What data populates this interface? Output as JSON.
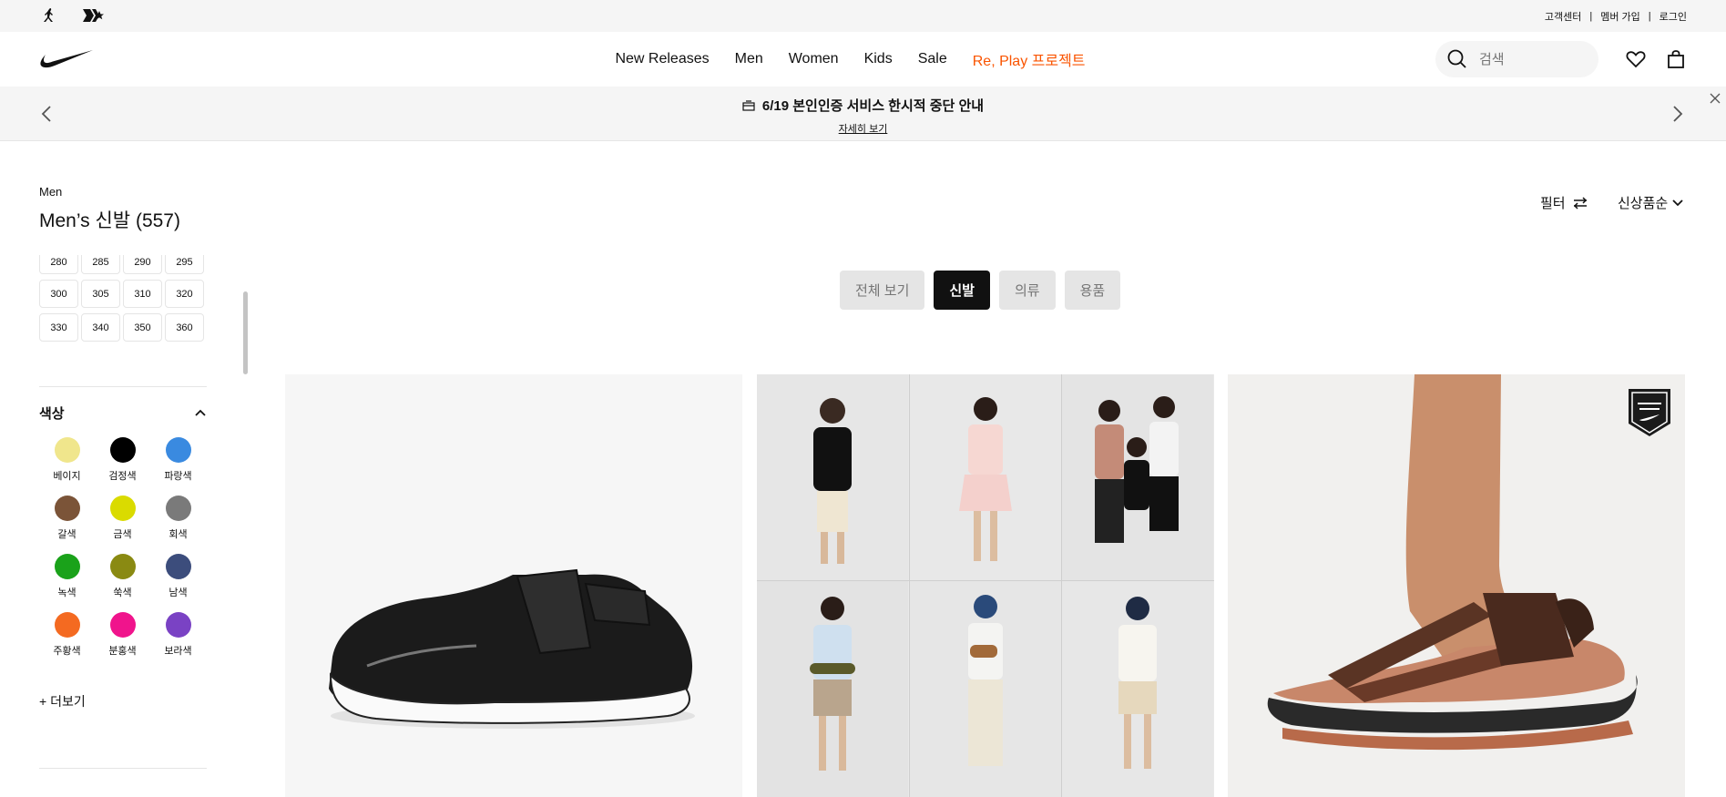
{
  "utility": {
    "links": [
      "고객센터",
      "멤버 가입",
      "로그인"
    ]
  },
  "nav": {
    "items": [
      "New Releases",
      "Men",
      "Women",
      "Kids",
      "Sale",
      "Re, Play 프로젝트"
    ]
  },
  "search": {
    "placeholder": "검색"
  },
  "promo": {
    "title": "6/19 본인인증 서비스 한시적 중단 안내",
    "link": "자세히 보기"
  },
  "page": {
    "breadcrumb": "Men",
    "title": "Men’s 신발 (557)",
    "filter_label": "필터",
    "sort_label": "신상품순"
  },
  "sizes": {
    "cut_row": [
      "280",
      "285",
      "290",
      "295"
    ],
    "rows": [
      [
        "300",
        "305",
        "310",
        "320"
      ],
      [
        "330",
        "340",
        "350",
        "360"
      ]
    ]
  },
  "colors": {
    "heading": "색상",
    "items": [
      {
        "label": "베이지",
        "hex": "#f0e68c"
      },
      {
        "label": "검정색",
        "hex": "#000000"
      },
      {
        "label": "파랑색",
        "hex": "#3a8ae0"
      },
      {
        "label": "갈색",
        "hex": "#7b5438"
      },
      {
        "label": "금색",
        "hex": "#dadb00"
      },
      {
        "label": "회색",
        "hex": "#7a7a7a"
      },
      {
        "label": "녹색",
        "hex": "#1aa21a"
      },
      {
        "label": "쑥색",
        "hex": "#8a8a12"
      },
      {
        "label": "남색",
        "hex": "#3c4d7c"
      },
      {
        "label": "주황색",
        "hex": "#f46a21"
      },
      {
        "label": "분홍색",
        "hex": "#f0148c"
      },
      {
        "label": "보라색",
        "hex": "#7a42c4"
      }
    ],
    "more": "+ 더보기"
  },
  "chips": [
    "전체 보기",
    "신발",
    "의류",
    "용품"
  ],
  "active_chip": "신발",
  "accent": "#fa5400"
}
